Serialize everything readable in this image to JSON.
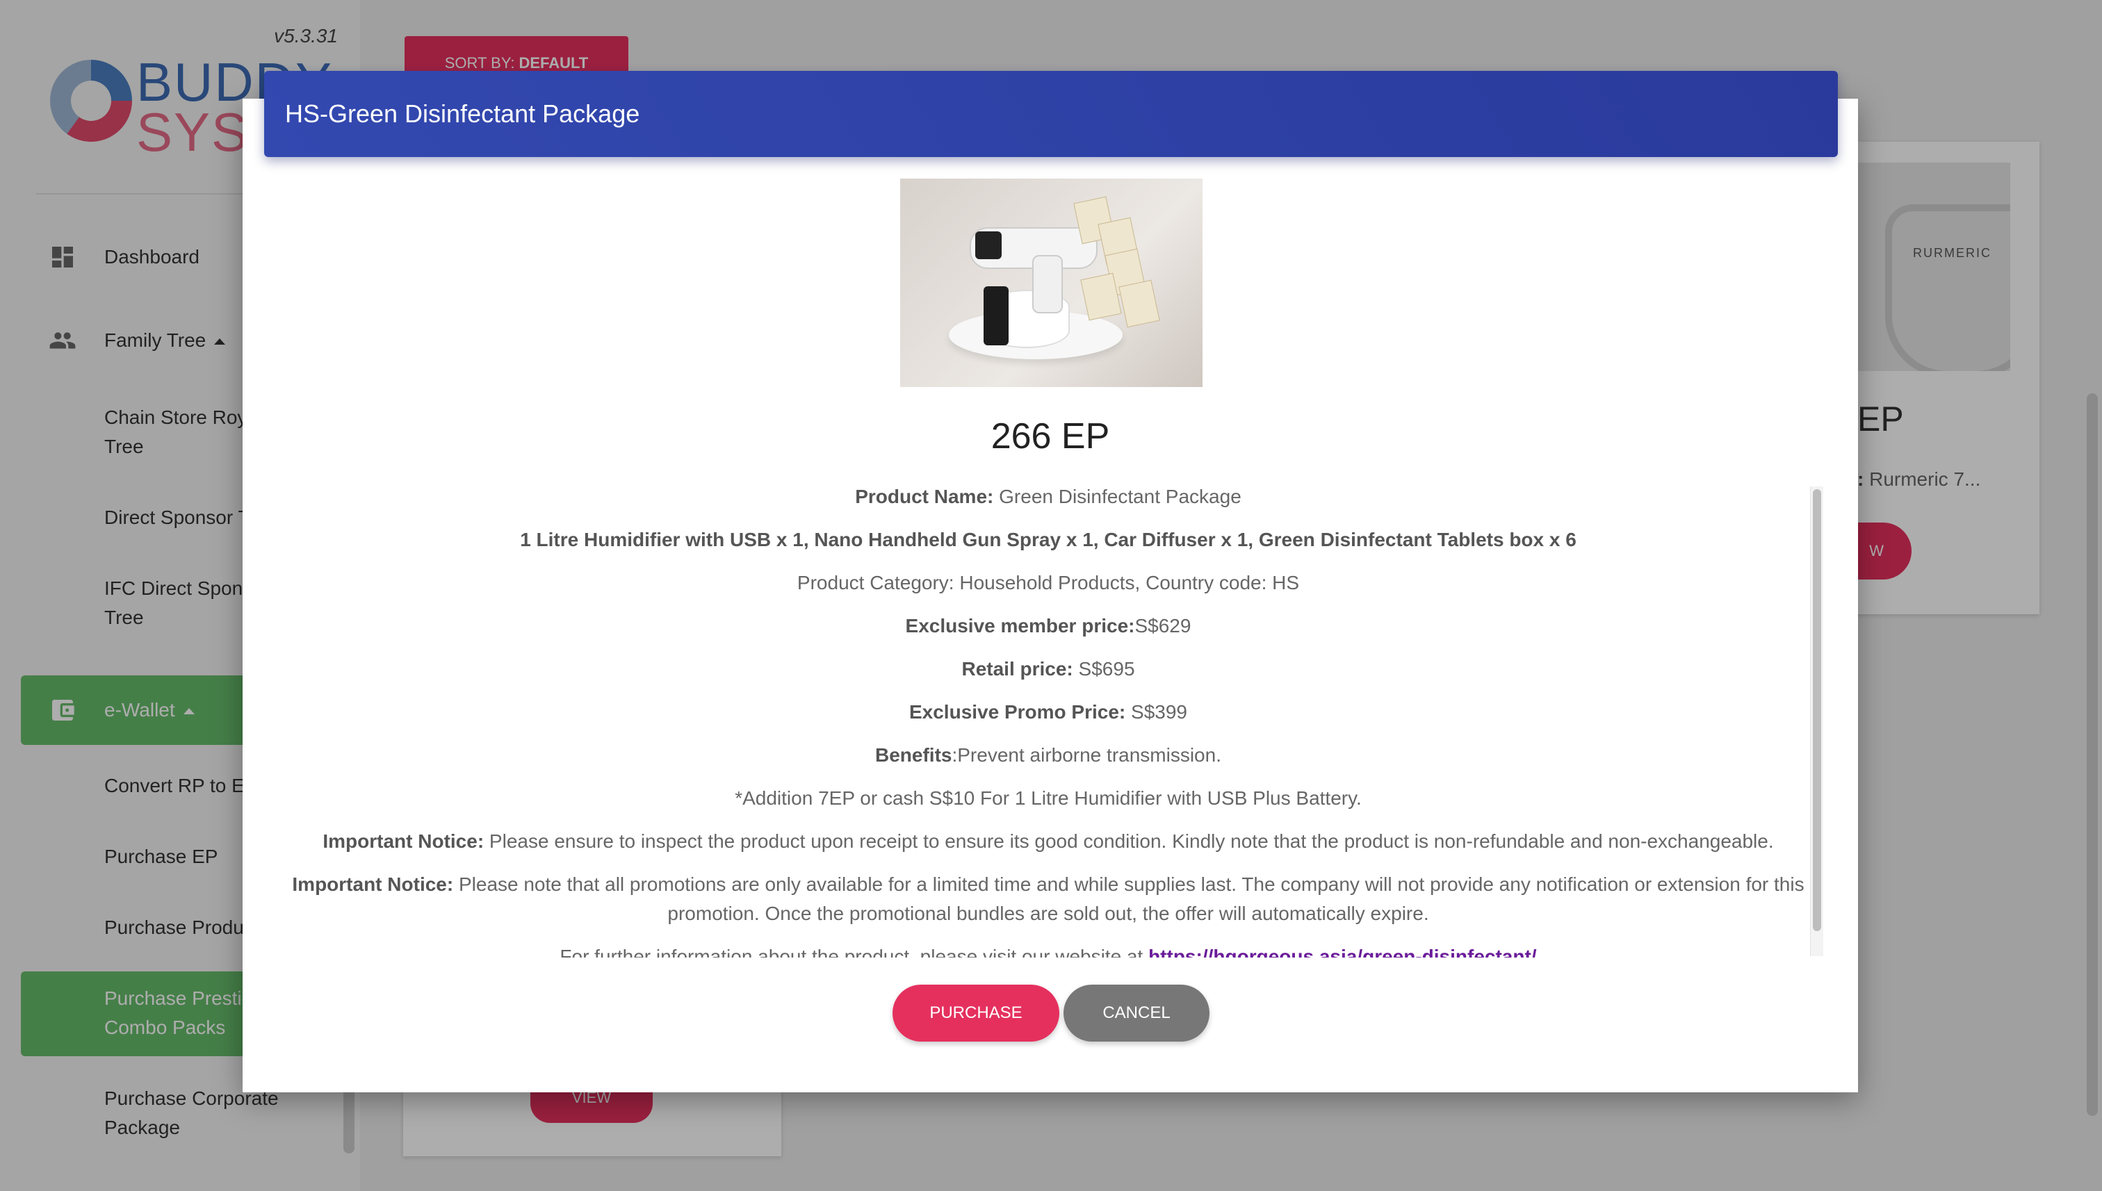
{
  "app": {
    "version": "v5.3.31",
    "logo_line1": "BUDDY",
    "logo_line2": "SYST"
  },
  "sidebar": {
    "items": [
      {
        "label": "Dashboard",
        "icon": "dashboard-icon"
      },
      {
        "label": "Family Tree",
        "icon": "people-icon"
      },
      {
        "label": "Chain Store Roya",
        "label2": "Tree"
      },
      {
        "label": "Direct Sponsor T"
      },
      {
        "label": "IFC Direct Spons",
        "label2": "Tree"
      },
      {
        "label": "e-Wallet",
        "icon": "wallet-icon"
      },
      {
        "label": "Convert RP to EP"
      },
      {
        "label": "Purchase EP"
      },
      {
        "label": "Purchase Produc"
      },
      {
        "label": "Purchase Prestig",
        "label2": "Combo Packs"
      },
      {
        "label": "Purchase Corporate",
        "label2": "Package"
      }
    ]
  },
  "main": {
    "sort_label": "SORT BY:",
    "sort_value": "DEFAULT",
    "right_card": {
      "brand": "RURMERIC",
      "price": "EP",
      "name_label": ":",
      "name_value": "Rurmeric 7...",
      "view_label": "W"
    },
    "left_card": {
      "view_label": "VIEW"
    }
  },
  "modal": {
    "title": "HS-Green Disinfectant Package",
    "price": "266 EP",
    "product_name_label": "Product Name:",
    "product_name": "Green Disinfectant Package",
    "contents": "1 Litre Humidifier with USB x 1, Nano Handheld Gun Spray x 1, Car Diffuser x 1, Green Disinfectant Tablets box x 6",
    "category": "Product Category: Household Products, Country code: HS",
    "member_price_label": "Exclusive member price:",
    "member_price": "S$629",
    "retail_price_label": "Retail price:",
    "retail_price": "S$695",
    "promo_price_label": "Exclusive Promo Price:",
    "promo_price": "S$399",
    "benefits_label": "Benefits",
    "benefits": ":Prevent airborne transmission.",
    "addition": "*Addition 7EP or cash S$10 For 1 Litre Humidifier with USB Plus Battery.",
    "notice1_label": "Important Notice:",
    "notice1": "Please ensure to inspect the product upon receipt to ensure its good condition. Kindly note that the product is non-refundable and non-exchangeable.",
    "notice2_label": "Important Notice:",
    "notice2": "Please note that all promotions are only available for a limited time and while supplies last. The company will not provide any notification or extension for this promotion. Once the promotional bundles are sold out, the offer will automatically expire.",
    "further_info": "For further information about the product, please visit our website at",
    "website": "https://hgorgeous.asia/green-disinfectant/",
    "purchase_label": "PURCHASE",
    "cancel_label": "CANCEL"
  },
  "colors": {
    "header": "#2f43a8",
    "accent": "#e5305e",
    "active_nav": "#66bb6a",
    "cancel": "#777777"
  }
}
